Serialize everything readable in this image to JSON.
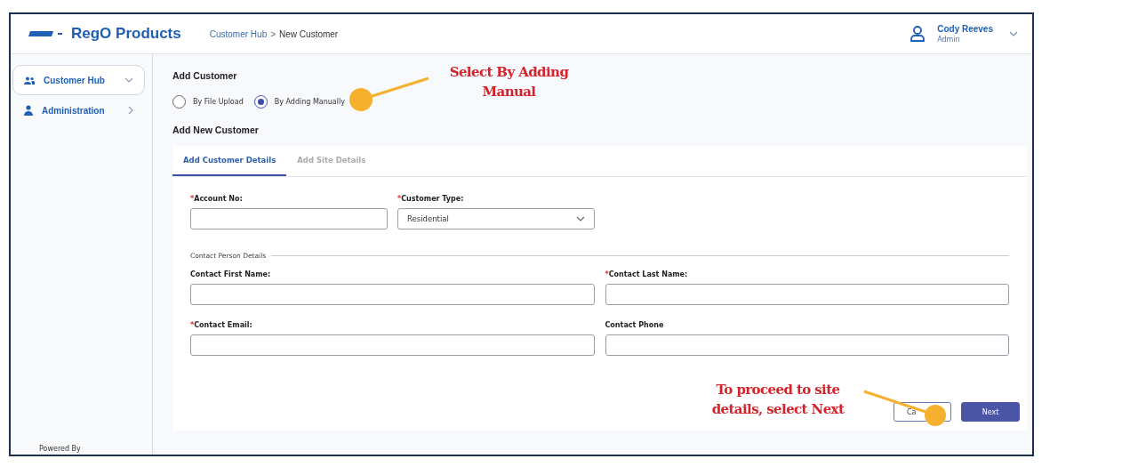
{
  "header": {
    "logo_text": "RegO Products",
    "breadcrumb": [
      {
        "label": "Customer Hub",
        "current": false
      },
      {
        "label": "New Customer",
        "current": true
      }
    ],
    "separator": ">",
    "user": {
      "name": "Cody Reeves",
      "role": "Admin"
    }
  },
  "sidebar": {
    "items": [
      {
        "label": "Customer Hub",
        "selected": true,
        "expanded": true
      },
      {
        "label": "Administration",
        "selected": false,
        "expanded": false
      }
    ],
    "footer": "Powered By"
  },
  "add_customer": {
    "title": "Add Customer",
    "options": [
      {
        "label": "By File Upload",
        "selected": false
      },
      {
        "label": "By Adding Manually",
        "selected": true
      }
    ]
  },
  "form": {
    "title": "Add New Customer",
    "tabs": [
      {
        "label": "Add Customer Details",
        "selected": true
      },
      {
        "label": "Add Site Details",
        "selected": false
      }
    ],
    "top_fields": [
      {
        "label": "Account No:",
        "required_mark": "*",
        "kind": "text"
      },
      {
        "label": "Customer Type:",
        "required_mark": "*",
        "kind": "select",
        "value": "Residential"
      }
    ],
    "section": "Contact Person Details",
    "contact_fields": [
      {
        "label": "Contact First Name:",
        "kind": "text"
      },
      {
        "label": "Contact Last Name:",
        "required_mark": "*",
        "kind": "text"
      },
      {
        "label": "Contact Email:",
        "required_mark": "*",
        "kind": "text"
      },
      {
        "label": "Contact Phone",
        "kind": "text"
      }
    ],
    "buttons": [
      {
        "label": "Ca",
        "kind": "secondary"
      },
      {
        "label": "Next",
        "kind": "primary"
      }
    ]
  },
  "callouts": [
    {
      "text": "Select By Adding Manual"
    },
    {
      "text": "To proceed to site details, select Next"
    }
  ]
}
